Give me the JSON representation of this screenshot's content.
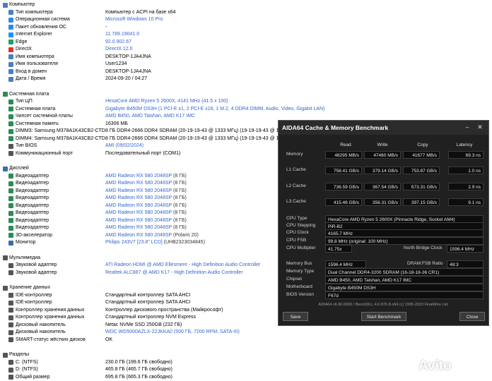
{
  "tree": [
    {
      "kind": "sect",
      "label": "Компьютер",
      "icon": "computer-icon",
      "color": "#4a7fc0"
    },
    {
      "kind": "item",
      "label": "Тип компьютера",
      "value": "Компьютер с ACPI на базе x64",
      "blue": false,
      "icon": "computer-icon",
      "color": "#4a7fc0"
    },
    {
      "kind": "item",
      "label": "Операционная система",
      "value": "Microsoft Windows 10 Pro",
      "blue": true,
      "icon": "windows-icon",
      "color": "#2d89ef"
    },
    {
      "kind": "item",
      "label": "Пакет обновления ОС",
      "value": "-",
      "blue": false,
      "icon": "update-icon",
      "color": "#2d89ef"
    },
    {
      "kind": "item",
      "label": "Internet Explorer",
      "value": "11.789.19041.0",
      "blue": true,
      "icon": "ie-icon",
      "color": "#1e90ff"
    },
    {
      "kind": "item",
      "label": "Edge",
      "value": "92.0.902.67",
      "blue": true,
      "icon": "edge-icon",
      "color": "#1aa260"
    },
    {
      "kind": "item",
      "label": "DirectX",
      "value": "DirectX 12.0",
      "blue": true,
      "icon": "directx-icon",
      "color": "#e03030"
    },
    {
      "kind": "item",
      "label": "Имя компьютера",
      "value": "DESKTOP-1JA4JNA",
      "blue": false,
      "icon": "computer-icon",
      "color": "#4a7fc0"
    },
    {
      "kind": "item",
      "label": "Имя пользователя",
      "value": "User1234",
      "blue": false,
      "icon": "user-icon",
      "color": "#4a7fc0"
    },
    {
      "kind": "item",
      "label": "Вход в домен",
      "value": "DESKTOP-1JA4JNA",
      "blue": false,
      "icon": "domain-icon",
      "color": "#4a7fc0"
    },
    {
      "kind": "item",
      "label": "Дата / Время",
      "value": "2024-09-20 / 04:27",
      "blue": false,
      "icon": "calendar-icon",
      "color": "#4a7fc0"
    },
    {
      "kind": "gap"
    },
    {
      "kind": "sect",
      "label": "Системная плата",
      "icon": "motherboard-icon",
      "color": "#2e8b57"
    },
    {
      "kind": "item",
      "label": "Тип ЦП",
      "value": "HexaCore AMD Ryzen 5 2600X, 4141 MHz (41.5 x 100)",
      "blue": true,
      "icon": "cpu-icon",
      "color": "#2e8b57"
    },
    {
      "kind": "item",
      "label": "Системная плата",
      "value": "Gigabyte B450M DS3H  (1 PCI-E x1, 2 PCI-E x16, 1 M.2, 4 DDR4 DIMM, Audio, Video, Gigabit LAN)",
      "blue": true,
      "icon": "motherboard-icon",
      "color": "#2e8b57"
    },
    {
      "kind": "item",
      "label": "Чипсет системной платы",
      "value": "AMD B450, AMD Taishan, AMD K17 IMC",
      "blue": true,
      "icon": "chipset-icon",
      "color": "#2e8b57"
    },
    {
      "kind": "item",
      "label": "Системная память",
      "value": "16306 МБ",
      "blue": false,
      "icon": "memory-icon",
      "color": "#2e8b57"
    },
    {
      "kind": "item",
      "label": "DIMM3: Samsung M378A1K43CB2-CTD",
      "value": "8 ГБ DDR4-2666 DDR4 SDRAM  (20-19-19-43 @ 1333 МГц)  (19-19-19-43 @ 1333 МГц)  (18-18-18-",
      "blue": false,
      "icon": "memory-icon",
      "color": "#2e8b57"
    },
    {
      "kind": "item",
      "label": "DIMM4: Samsung M378A1K43CB2-CTD",
      "value": "8 ГБ DDR4-2666 DDR4 SDRAM  (20-19-19-43 @ 1333 МГц)  (19-19-19-43 @ 1333 МГц)  (18-18-18-",
      "blue": false,
      "icon": "memory-icon",
      "color": "#2e8b57"
    },
    {
      "kind": "item",
      "label": "Тип BIOS",
      "value": "AMI (09/02/2024)",
      "blue": true,
      "icon": "bios-icon",
      "color": "#555555"
    },
    {
      "kind": "item",
      "label": "Коммуникационный порт",
      "value": "Последовательный порт (COM1)",
      "blue": false,
      "icon": "port-icon",
      "color": "#555555"
    },
    {
      "kind": "gap"
    },
    {
      "kind": "sect",
      "label": "Дисплей",
      "icon": "display-icon",
      "color": "#3a6ea5"
    },
    {
      "kind": "item",
      "label": "Видеоадаптер",
      "value": "AMD Radeon RX 580 2048SP",
      "sub": "  (8 ГБ)",
      "blue": true,
      "icon": "gpu-icon",
      "color": "#2e8b57"
    },
    {
      "kind": "item",
      "label": "Видеоадаптер",
      "value": "AMD Radeon RX 580 2048SP",
      "sub": "  (8 ГБ)",
      "blue": true,
      "icon": "gpu-icon",
      "color": "#2e8b57"
    },
    {
      "kind": "item",
      "label": "Видеоадаптер",
      "value": "AMD Radeon RX 580 2048SP",
      "sub": "  (8 ГБ)",
      "blue": true,
      "icon": "gpu-icon",
      "color": "#2e8b57"
    },
    {
      "kind": "item",
      "label": "Видеоадаптер",
      "value": "AMD Radeon RX 580 2048SP",
      "sub": "  (8 ГБ)",
      "blue": true,
      "icon": "gpu-icon",
      "color": "#2e8b57"
    },
    {
      "kind": "item",
      "label": "Видеоадаптер",
      "value": "AMD Radeon RX 580 2048SP",
      "sub": "  (8 ГБ)",
      "blue": true,
      "icon": "gpu-icon",
      "color": "#2e8b57"
    },
    {
      "kind": "item",
      "label": "Видеоадаптер",
      "value": "AMD Radeon RX 580 2048SP",
      "sub": "  (8 ГБ)",
      "blue": true,
      "icon": "gpu-icon",
      "color": "#2e8b57"
    },
    {
      "kind": "item",
      "label": "Видеоадаптер",
      "value": "AMD Radeon RX 580 2048SP",
      "sub": "  (8 ГБ)",
      "blue": true,
      "icon": "gpu-icon",
      "color": "#2e8b57"
    },
    {
      "kind": "item",
      "label": "Видеоадаптер",
      "value": "AMD Radeon RX 580 2048SP",
      "sub": "  (8 ГБ)",
      "blue": true,
      "icon": "gpu-icon",
      "color": "#2e8b57"
    },
    {
      "kind": "item",
      "label": "3D-акселератор",
      "value": "AMD Radeon RX 580 2048SP",
      "sub": "  (Polaris 20)",
      "blue": true,
      "icon": "accelerator-icon",
      "color": "#2e8b57"
    },
    {
      "kind": "item",
      "label": "Монитор",
      "value": "Philips 243V7  [23.8\" LCD]",
      "sub": "  (UHB2323034845)",
      "blue": true,
      "icon": "monitor-icon",
      "color": "#3a6ea5"
    },
    {
      "kind": "gap"
    },
    {
      "kind": "sect",
      "label": "Мультимедиа",
      "icon": "multimedia-icon",
      "color": "#555555"
    },
    {
      "kind": "item",
      "label": "Звуковой адаптер",
      "value": "ATI Radeon HDMI @ AMD Ellesmere - High Definition Audio Controller",
      "blue": true,
      "icon": "speaker-icon",
      "color": "#555555"
    },
    {
      "kind": "item",
      "label": "Звуковой адаптер",
      "value": "Realtek ALC887 @ AMD K17 - High Definition Audio Controller",
      "blue": true,
      "icon": "speaker-icon",
      "color": "#555555"
    },
    {
      "kind": "gap"
    },
    {
      "kind": "sect",
      "label": "Хранение данных",
      "icon": "storage-icon",
      "color": "#555555"
    },
    {
      "kind": "item",
      "label": "IDE-контроллер",
      "value": "Стандартный контроллер SATA AHCI",
      "blue": false,
      "icon": "controller-icon",
      "color": "#555555"
    },
    {
      "kind": "item",
      "label": "IDE-контроллер",
      "value": "Стандартный контроллер SATA AHCI",
      "blue": false,
      "icon": "controller-icon",
      "color": "#555555"
    },
    {
      "kind": "item",
      "label": "Контроллер хранения данных",
      "value": "Контроллер дискового пространства (Майкрософт)",
      "blue": false,
      "icon": "controller-icon",
      "color": "#555555"
    },
    {
      "kind": "item",
      "label": "Контроллер хранения данных",
      "value": "Стандартный контроллер NVM Express",
      "blue": false,
      "icon": "controller-icon",
      "color": "#555555"
    },
    {
      "kind": "item",
      "label": "Дисковый накопитель",
      "value": "Netac NVMe SSD 250GB  (232 ГБ)",
      "blue": false,
      "icon": "disk-icon",
      "color": "#555555"
    },
    {
      "kind": "item",
      "label": "Дисковый накопитель",
      "value": "WDC WD5000AZLX-22JKKA0  (500 ГБ, 7200 RPM, SATA-III)",
      "blue": true,
      "icon": "disk-icon",
      "color": "#555555"
    },
    {
      "kind": "item",
      "label": "SMART-статус жёстких дисков",
      "value": "OK",
      "blue": false,
      "icon": "smart-icon",
      "color": "#555555"
    },
    {
      "kind": "gap"
    },
    {
      "kind": "sect",
      "label": "Разделы",
      "icon": "partition-icon",
      "color": "#555555"
    },
    {
      "kind": "item",
      "label": "C: (NTFS)",
      "value": "230.0 ГБ (199.6 ГБ свободно)",
      "blue": false,
      "icon": "drive-icon",
      "color": "#555555"
    },
    {
      "kind": "item",
      "label": "D: (NTFS)",
      "value": "465.8 ГБ (465.7 ГБ свободно)",
      "blue": false,
      "icon": "drive-icon",
      "color": "#555555"
    },
    {
      "kind": "item",
      "label": "Общий размер",
      "value": "695.8 ГБ (665.3 ГБ свободно)",
      "blue": false,
      "icon": "drive-icon",
      "color": "#555555"
    }
  ],
  "bench": {
    "title": "AIDA64 Cache & Memory Benchmark",
    "headers": [
      "Read",
      "Write",
      "Copy",
      "Latency"
    ],
    "rows": [
      {
        "label": "Memory",
        "read": "48295 MB/s",
        "write": "47460 MB/s",
        "copy": "41677 MB/s",
        "latency": "69.3 ns"
      },
      {
        "label": "L1 Cache",
        "read": "758.41 GB/s",
        "write": "379.14 GB/s",
        "copy": "753.87 GB/s",
        "latency": "1.0 ns"
      },
      {
        "label": "L2 Cache",
        "read": "736.59 GB/s",
        "write": "367.54 GB/s",
        "copy": "673.31 GB/s",
        "latency": "2.9 ns"
      },
      {
        "label": "L3 Cache",
        "read": "415.46 GB/s",
        "write": "356.31 GB/s",
        "copy": "397.15 GB/s",
        "latency": "9.1 ns"
      }
    ],
    "info": {
      "cpu_type_label": "CPU Type",
      "cpu_type": "HexaCore AMD Ryzen 5 2600X  (Pinnacle Ridge, Socket AM4)",
      "cpu_stepping_label": "CPU Stepping",
      "cpu_stepping": "PiR-B2",
      "cpu_clock_label": "CPU Clock",
      "cpu_clock": "4165.7 MHz",
      "cpu_fsb_label": "CPU FSB",
      "cpu_fsb": "99.8 MHz  (original: 100 MHz)",
      "cpu_mult_label": "CPU Multiplier",
      "cpu_mult": "41.75x",
      "nb_clock_label": "North Bridge Clock",
      "nb_clock": "1596.4 MHz",
      "mem_bus_label": "Memory Bus",
      "mem_bus": "1596.4 MHz",
      "dram_fsb_label": "DRAM:FSB Ratio",
      "dram_fsb": "48:3",
      "mem_type_label": "Memory Type",
      "mem_type": "Dual Channel DDR4-3200 SDRAM  (16-18-18-36 CR1)",
      "chipset_label": "Chipset",
      "chipset": "AMD B450, AMD Taishan, AMD K17 IMC",
      "motherboard_label": "Motherboard",
      "motherboard": "Gigabyte B450M DS3H",
      "bios_label": "BIOS Version",
      "bios": "F67d"
    },
    "footer": "AIDA64 v6.90.6500 / BenchDLL 4.6.876.8-x64  (c) 1995-2023 FinalWire Ltd.",
    "save_label": "Save",
    "start_label": "Start Benchmark",
    "close_label": "Close"
  },
  "watermark": "Avito"
}
